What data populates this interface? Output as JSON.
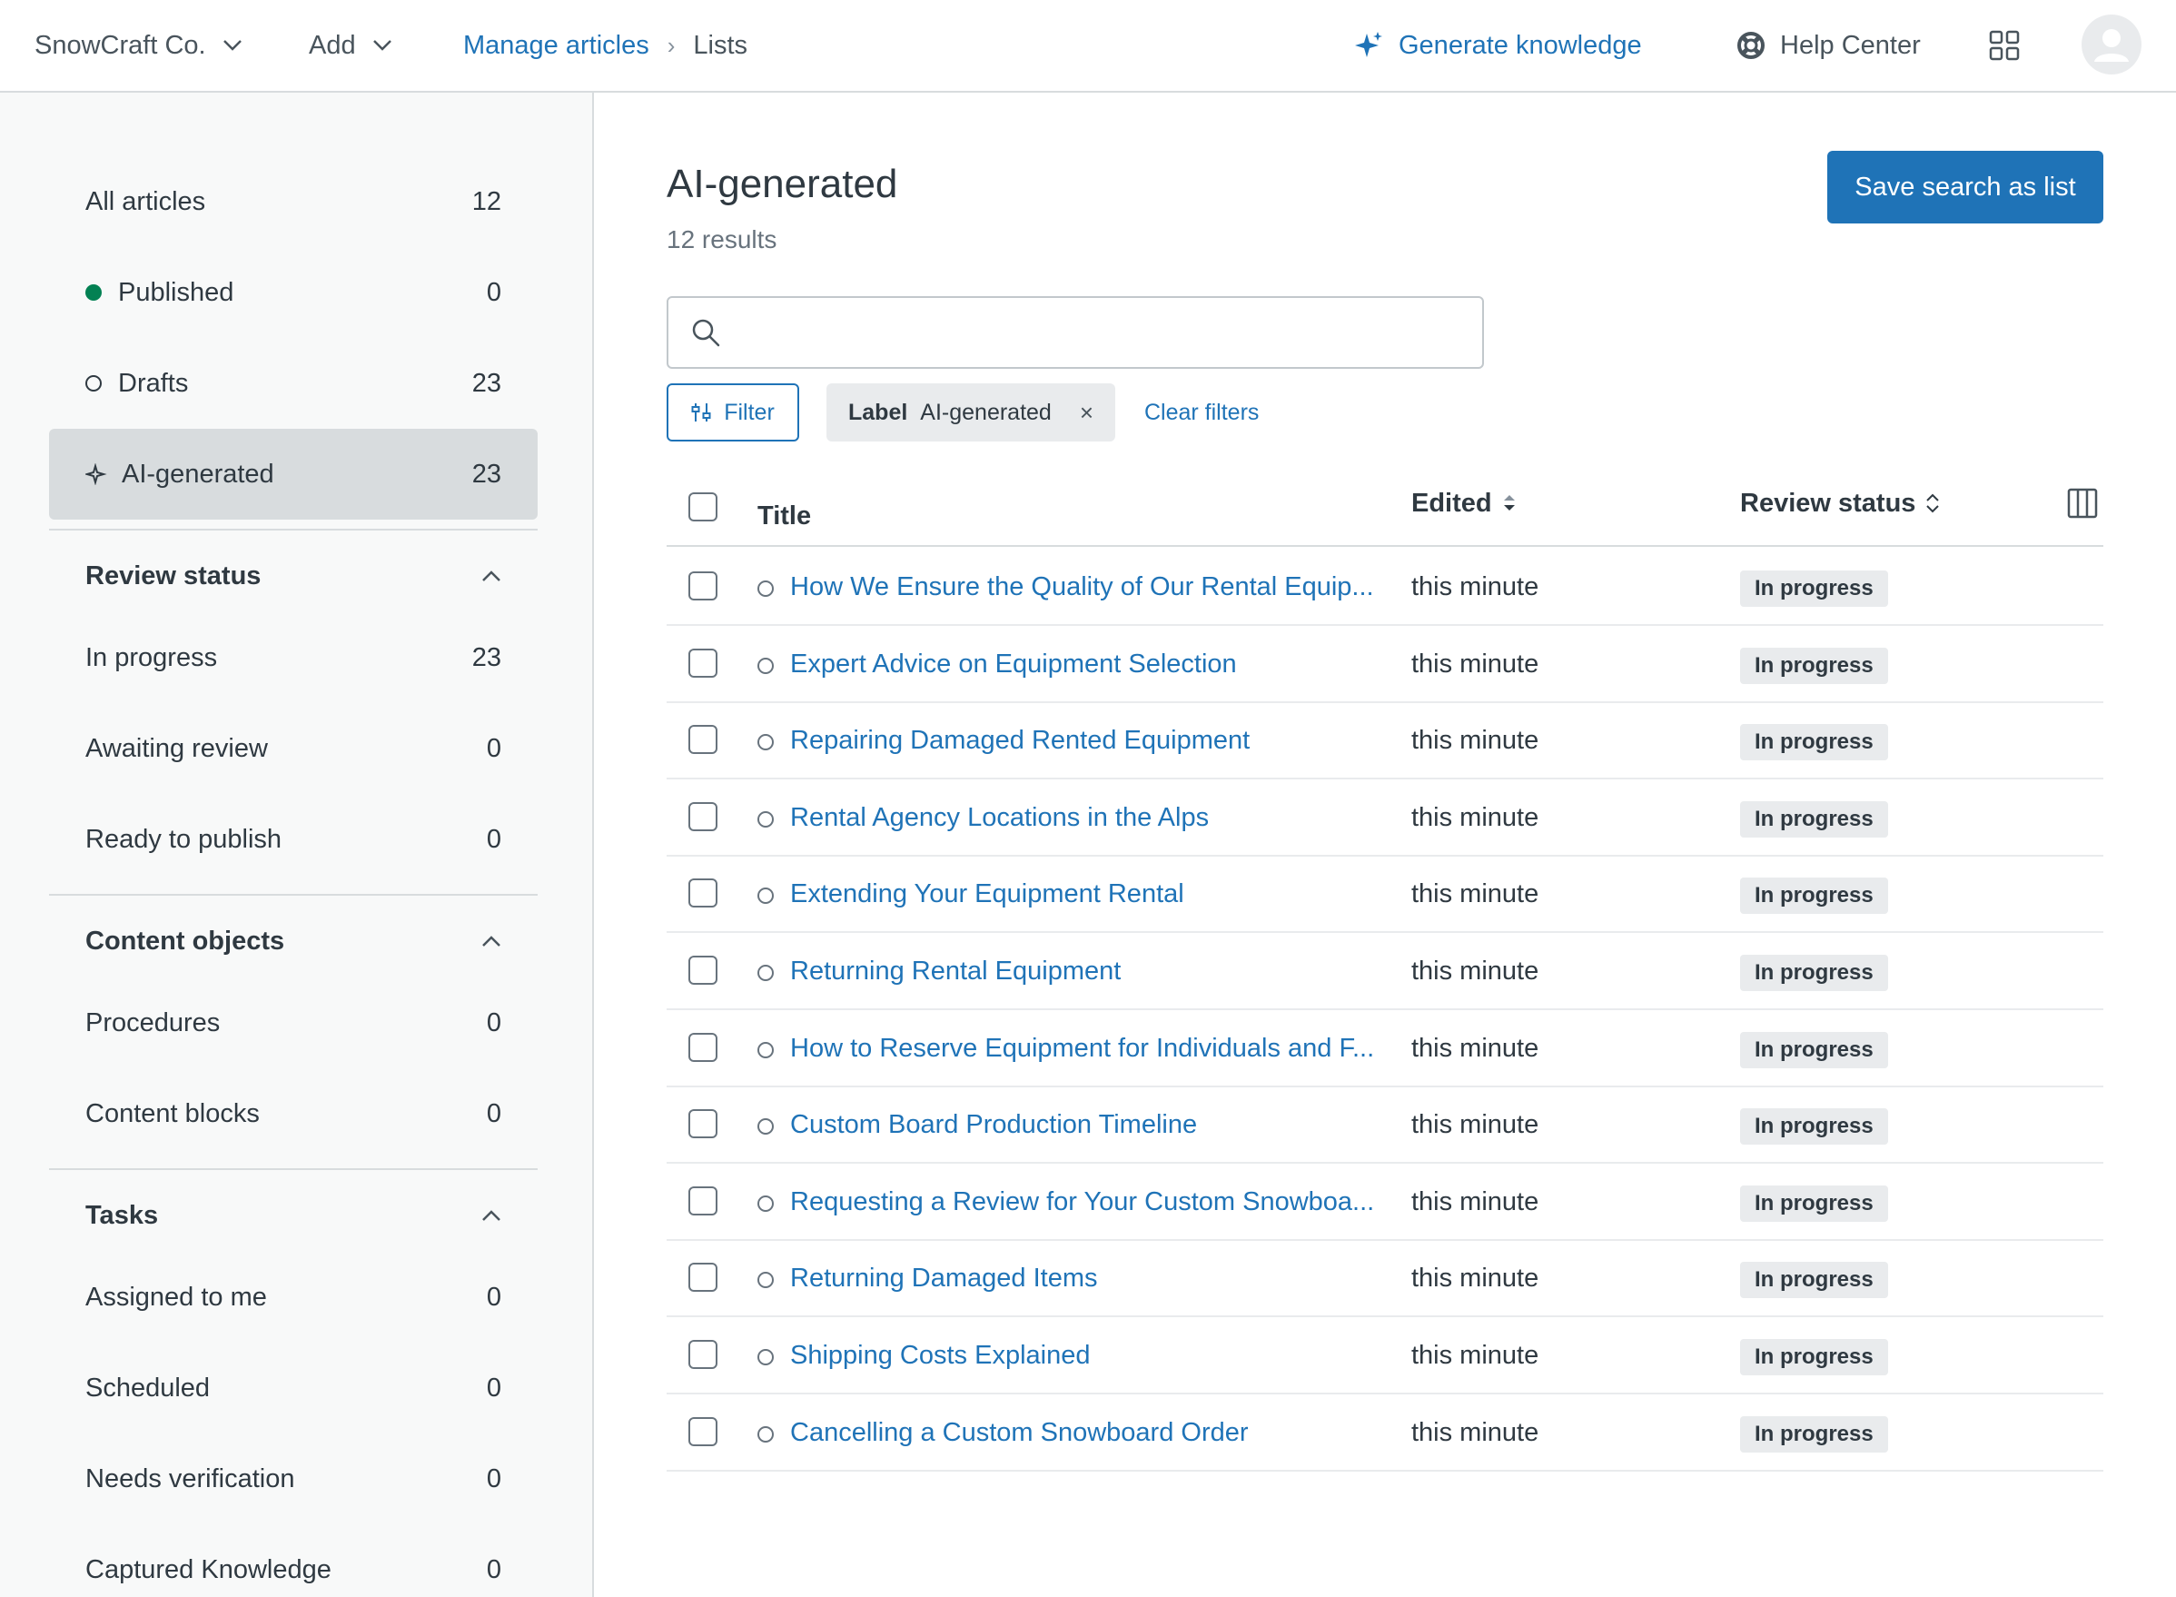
{
  "topbar": {
    "brand": "SnowCraft Co.",
    "add": "Add",
    "breadcrumb": {
      "link": "Manage articles",
      "current": "Lists"
    },
    "generate": "Generate knowledge",
    "help": "Help Center",
    "accent": "#1f73b7"
  },
  "sidebar": {
    "main": [
      {
        "label": "All articles",
        "count": "12"
      },
      {
        "label": "Published",
        "count": "0"
      },
      {
        "label": "Drafts",
        "count": "23"
      },
      {
        "label": "AI-generated",
        "count": "23"
      }
    ],
    "review": {
      "title": "Review status",
      "items": [
        {
          "label": "In progress",
          "count": "23"
        },
        {
          "label": "Awaiting review",
          "count": "0"
        },
        {
          "label": "Ready to publish",
          "count": "0"
        }
      ]
    },
    "content": {
      "title": "Content objects",
      "items": [
        {
          "label": "Procedures",
          "count": "0"
        },
        {
          "label": "Content blocks",
          "count": "0"
        }
      ]
    },
    "tasks": {
      "title": "Tasks",
      "items": [
        {
          "label": "Assigned to me",
          "count": "0"
        },
        {
          "label": "Scheduled",
          "count": "0"
        },
        {
          "label": "Needs verification",
          "count": "0"
        },
        {
          "label": "Captured Knowledge",
          "count": "0"
        }
      ]
    }
  },
  "main": {
    "title": "AI-generated",
    "results": "12 results",
    "save_button": "Save search as list",
    "search_placeholder": "",
    "filter_button": "Filter",
    "tag": {
      "key": "Label",
      "value": "AI-generated",
      "remove": "×"
    },
    "clear_filters": "Clear filters",
    "columns": {
      "title": "Title",
      "edited": "Edited",
      "review": "Review status"
    },
    "rows": [
      {
        "title": "How We Ensure the Quality of Our Rental Equip...",
        "edited": "this minute",
        "status": "In progress"
      },
      {
        "title": "Expert Advice on Equipment Selection",
        "edited": "this minute",
        "status": "In progress"
      },
      {
        "title": "Repairing Damaged Rented Equipment",
        "edited": "this minute",
        "status": "In progress"
      },
      {
        "title": "Rental Agency Locations in the Alps",
        "edited": "this minute",
        "status": "In progress"
      },
      {
        "title": "Extending Your Equipment Rental",
        "edited": "this minute",
        "status": "In progress"
      },
      {
        "title": "Returning Rental Equipment",
        "edited": "this minute",
        "status": "In progress"
      },
      {
        "title": "How to Reserve Equipment for Individuals and F...",
        "edited": "this minute",
        "status": "In progress"
      },
      {
        "title": "Custom Board Production Timeline",
        "edited": "this minute",
        "status": "In progress"
      },
      {
        "title": "Requesting a Review for Your Custom Snowboa...",
        "edited": "this minute",
        "status": "In progress"
      },
      {
        "title": "Returning Damaged Items",
        "edited": "this minute",
        "status": "In progress"
      },
      {
        "title": "Shipping Costs Explained",
        "edited": "this minute",
        "status": "In progress"
      },
      {
        "title": "Cancelling a Custom Snowboard Order",
        "edited": "this minute",
        "status": "In progress"
      }
    ]
  }
}
